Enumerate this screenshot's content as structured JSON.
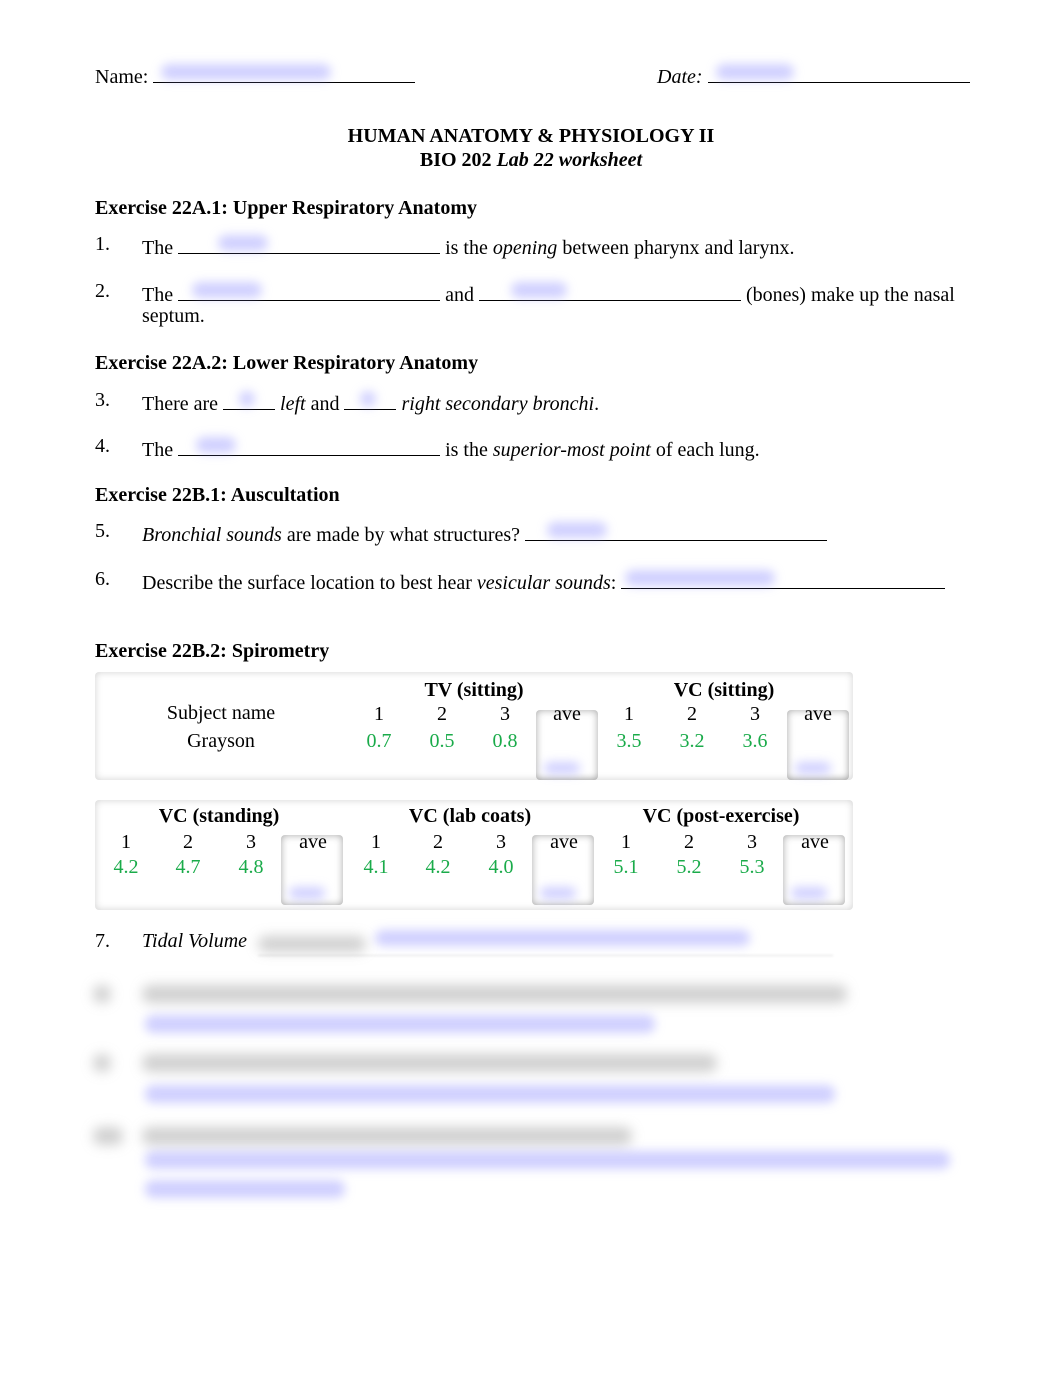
{
  "header": {
    "name_label": "Name:",
    "name_value_redacted": true,
    "date_label": "Date:",
    "date_value_redacted": true,
    "title": "HUMAN ANATOMY & PHYSIOLOGY II",
    "subtitle_prefix": "BIO 202",
    "subtitle_italic": "Lab 22 worksheet"
  },
  "exercises": {
    "ex1": {
      "title": "Exercise 22A.1: Upper Respiratory Anatomy",
      "q1": {
        "num": "1.",
        "pre": "The",
        "mid": "is the",
        "italic": "opening",
        "post": "between pharynx and larynx."
      },
      "q2": {
        "num": "2.",
        "pre": "The",
        "mid": "and",
        "post": "(bones) make up the nasal",
        "cont": "septum."
      }
    },
    "ex2": {
      "title": "Exercise 22A.2: Lower Respiratory Anatomy",
      "q3": {
        "num": "3.",
        "pre": "There are",
        "italic1": "left",
        "mid": "and",
        "italic2": "right secondary bronchi",
        "post": "."
      },
      "q4": {
        "num": "4.",
        "pre": "The",
        "mid": "is the",
        "italic": "superior-most point",
        "post": "of each lung."
      }
    },
    "ex3": {
      "title": "Exercise 22B.1: Auscultation",
      "q5": {
        "num": "5.",
        "italic": "Bronchial sounds",
        "post": "are made by what structures?"
      },
      "q6": {
        "num": "6.",
        "pre": "Describe the surface location to best hear",
        "italic": "vesicular sounds",
        "post": ":"
      }
    },
    "ex4": {
      "title": "Exercise 22B.2: Spirometry",
      "subject_header": "Subject name",
      "subject": "Grayson",
      "trial_labels": [
        "1",
        "2",
        "3",
        "ave"
      ],
      "groups": [
        {
          "label": "TV (sitting)",
          "values": [
            "0.7",
            "0.5",
            "0.8"
          ]
        },
        {
          "label": "VC (sitting)",
          "values": [
            "3.5",
            "3.2",
            "3.6"
          ]
        },
        {
          "label": "VC (standing)",
          "values": [
            "4.2",
            "4.7",
            "4.8"
          ]
        },
        {
          "label": "VC (lab coats)",
          "values": [
            "4.1",
            "4.2",
            "4.0"
          ]
        },
        {
          "label": "VC (post-exercise)",
          "values": [
            "5.1",
            "5.2",
            "5.3"
          ]
        }
      ],
      "q7": {
        "num": "7.",
        "italic": "Tidal Volume"
      }
    }
  },
  "colors": {
    "answer_green": "#1aab4a",
    "redaction_blue": "#9696ff"
  }
}
